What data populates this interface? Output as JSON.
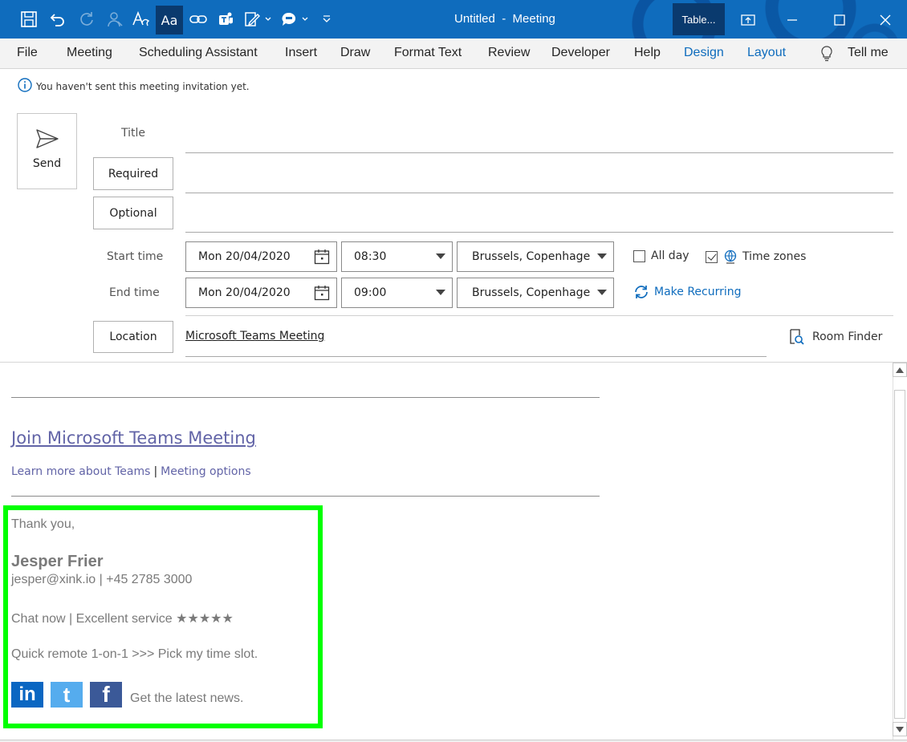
{
  "window": {
    "title": "Untitled  -  Meeting",
    "context_tab": "Table...",
    "titlebar_color": "#0f6cbd"
  },
  "quick_access": {
    "icons": [
      "save-icon",
      "undo-icon",
      "redo-icon",
      "assign-icon",
      "format-text-icon",
      "font-aa-icon",
      "link-icon",
      "teams-icon",
      "edit-icon",
      "chat-icon",
      "customize-icon"
    ],
    "font_button_label": "Aa"
  },
  "ribbon": {
    "tabs": [
      "File",
      "Meeting",
      "Scheduling Assistant",
      "Insert",
      "Draw",
      "Format Text",
      "Review",
      "Developer",
      "Help",
      "Design",
      "Layout"
    ],
    "tell_me": "Tell me",
    "context_color": "#0f6cbd"
  },
  "info": {
    "message": "You haven't sent this meeting invitation yet."
  },
  "form": {
    "send_label": "Send",
    "title_label": "Title",
    "required_label": "Required",
    "optional_label": "Optional",
    "start_label": "Start time",
    "end_label": "End time",
    "start_date": "Mon 20/04/2020",
    "start_time": "08:30",
    "end_date": "Mon 20/04/2020",
    "end_time": "09:00",
    "timezone_start": "Brussels, Copenhagen, I",
    "timezone_end": "Brussels, Copenhagen, I",
    "all_day_label": "All day",
    "all_day_checked": false,
    "time_zones_label": "Time zones",
    "time_zones_checked": true,
    "make_recurring_label": "Make Recurring",
    "location_label": "Location",
    "location_value": "Microsoft Teams Meeting",
    "room_finder_label": "Room Finder"
  },
  "body": {
    "join_link": "Join Microsoft Teams Meeting",
    "learn_more": "Learn more about Teams",
    "separator": "|",
    "meeting_options": "Meeting options",
    "teams_color": "#6264a7"
  },
  "signature": {
    "greeting": "Thank you,",
    "name": "Jesper Frier",
    "contact": "jesper@xink.io | +45 2785 3000",
    "chat_line": "Chat now | Excellent service ★★★★★",
    "remote_line": "Quick remote 1-on-1 >>> Pick my time slot.",
    "news_text": "Get the latest news.",
    "social": [
      {
        "label": "in",
        "color": "#0a66c2",
        "icon": "linkedin-icon"
      },
      {
        "label": "t",
        "color": "#55acee",
        "icon": "twitter-icon"
      },
      {
        "label": "f",
        "color": "#3b5998",
        "icon": "facebook-icon"
      }
    ],
    "highlight_color": "#00ff00"
  }
}
